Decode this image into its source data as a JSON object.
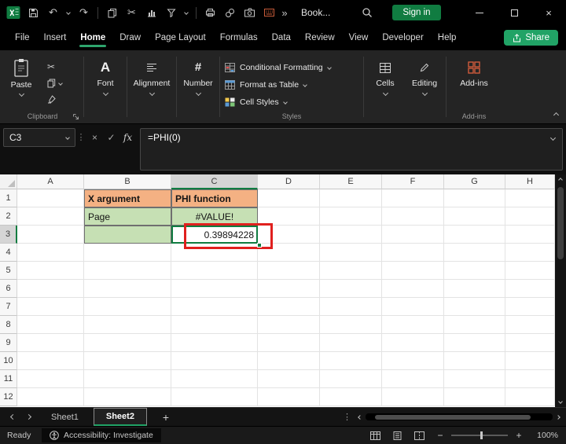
{
  "titlebar": {
    "workbook_name": "Book...",
    "sign_in": "Sign in"
  },
  "menubar": {
    "tabs": [
      "File",
      "Insert",
      "Home",
      "Draw",
      "Page Layout",
      "Formulas",
      "Data",
      "Review",
      "View",
      "Developer",
      "Help"
    ],
    "active_tab": "Home",
    "share": "Share"
  },
  "ribbon": {
    "paste": "Paste",
    "group_clipboard": "Clipboard",
    "font": "Font",
    "alignment": "Alignment",
    "number": "Number",
    "conditional_formatting": "Conditional Formatting",
    "format_as_table": "Format as Table",
    "cell_styles": "Cell Styles",
    "group_styles": "Styles",
    "cells": "Cells",
    "editing": "Editing",
    "addins": "Add-ins",
    "group_addins": "Add-ins"
  },
  "formula_bar": {
    "name_box": "C3",
    "fx": "fx",
    "formula": "=PHI(0)"
  },
  "grid": {
    "columns": [
      "A",
      "B",
      "C",
      "D",
      "E",
      "F",
      "G",
      "H"
    ],
    "row_labels": [
      "1",
      "2",
      "3",
      "4",
      "5",
      "6",
      "7",
      "8",
      "9",
      "10",
      "11",
      "12"
    ],
    "selected_column": "C",
    "selected_row": "3",
    "selected_cell": "C3",
    "cells": [
      {
        "ref": "B1",
        "text": "X argument",
        "fill": "orange",
        "bold": true,
        "border": true
      },
      {
        "ref": "C1",
        "text": "PHI function",
        "fill": "orange",
        "bold": true,
        "border": true
      },
      {
        "ref": "B2",
        "text": "Page",
        "fill": "green",
        "border": true
      },
      {
        "ref": "C2",
        "text": "#VALUE!",
        "fill": "green",
        "align": "center",
        "border": true
      },
      {
        "ref": "B3",
        "text": "",
        "fill": "green",
        "border": true
      },
      {
        "ref": "C3",
        "text": "0.39894228",
        "align": "right",
        "border": true,
        "active": true,
        "annotated": true
      }
    ]
  },
  "sheet_bar": {
    "sheet1": "Sheet1",
    "sheet2": "Sheet2",
    "active": "Sheet2"
  },
  "status_bar": {
    "mode": "Ready",
    "accessibility": "Accessibility: Investigate",
    "zoom_level": "100%"
  },
  "icons": {
    "undo": "↶",
    "redo": "↷",
    "cut": "✂",
    "more": "»",
    "dots": "⋮",
    "cancel": "×",
    "confirm": "✓",
    "close": "×",
    "add_sheet": "+",
    "zoom_out": "−",
    "zoom_in": "+",
    "font_big_a": "A",
    "number_hash": "#"
  },
  "colors": {
    "accent_green": "#107C41",
    "share_green": "#21A366",
    "orange_fill": "#F4B183",
    "green_fill": "#C6E0B4",
    "annotation_red": "#E0201E"
  }
}
